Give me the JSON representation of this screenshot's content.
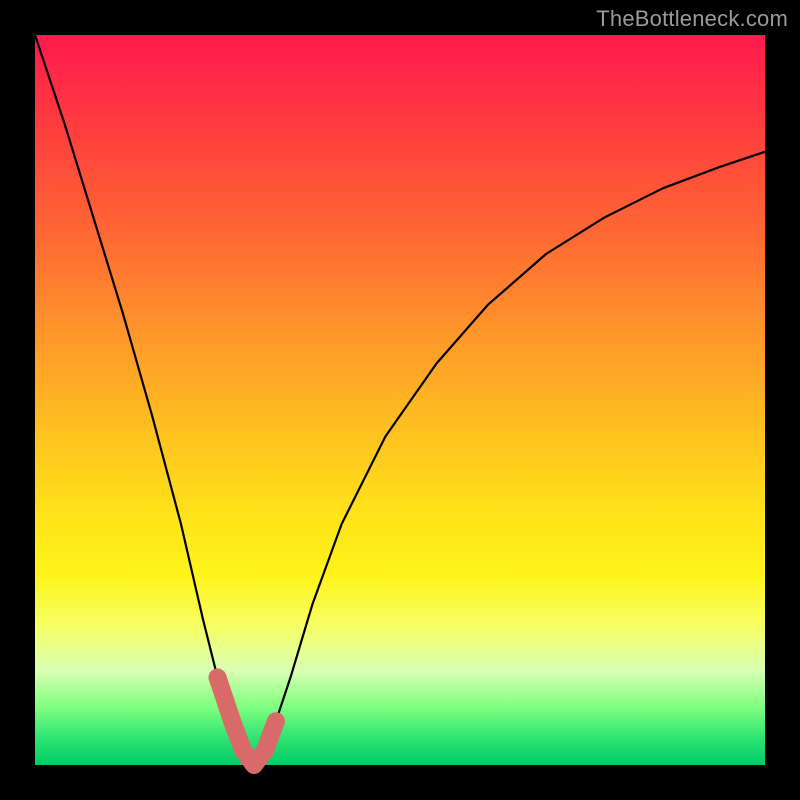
{
  "watermark": "TheBottleneck.com",
  "chart_data": {
    "type": "line",
    "title": "",
    "xlabel": "",
    "ylabel": "",
    "xlim": [
      0,
      100
    ],
    "ylim": [
      0,
      100
    ],
    "grid": false,
    "legend": false,
    "series": [
      {
        "name": "bottleneck-curve",
        "color": "#000000",
        "x": [
          0,
          4,
          8,
          12,
          16,
          20,
          23,
          25,
          27,
          28.5,
          30,
          31.5,
          33,
          35,
          38,
          42,
          48,
          55,
          62,
          70,
          78,
          86,
          94,
          100
        ],
        "values": [
          100,
          88,
          75,
          62,
          48,
          33,
          20,
          12,
          6,
          2,
          0,
          2,
          6,
          12,
          22,
          33,
          45,
          55,
          63,
          70,
          75,
          79,
          82,
          84
        ]
      }
    ],
    "highlight": {
      "name": "optimal-range-marker",
      "color": "#d96a6a",
      "x": [
        25,
        27,
        28.5,
        30,
        31.5,
        33
      ],
      "values": [
        12,
        6,
        2,
        0,
        2,
        6
      ]
    },
    "background_gradient": {
      "top_color": "#ff1a4d",
      "mid_color": "#ffe31a",
      "bottom_color": "#00cc66"
    }
  }
}
